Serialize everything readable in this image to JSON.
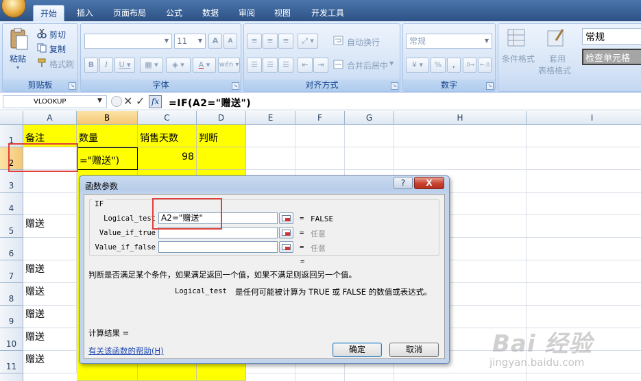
{
  "tabs": [
    {
      "label": "开始",
      "active": true
    },
    {
      "label": "插入"
    },
    {
      "label": "页面布局"
    },
    {
      "label": "公式"
    },
    {
      "label": "数据"
    },
    {
      "label": "审阅"
    },
    {
      "label": "视图"
    },
    {
      "label": "开发工具"
    }
  ],
  "ribbon": {
    "clipboard": {
      "paste": "粘贴",
      "cut": "剪切",
      "copy": "复制",
      "format_painter": "格式刷",
      "group": "剪贴板"
    },
    "font": {
      "name": "",
      "size": "11",
      "group": "字体"
    },
    "alignment": {
      "wrap": "自动换行",
      "merge": "合并后居中",
      "group": "对齐方式"
    },
    "number": {
      "format": "常规",
      "percent": "%",
      "comma": ",",
      "group": "数字"
    },
    "styles": {
      "conditional": "条件格式",
      "table_a": "套用",
      "table_b": "表格格式",
      "style_normal": "常规",
      "style_check": "检查单元格"
    }
  },
  "formula_bar": {
    "name_box": "VLOOKUP",
    "formula": "=IF(A2=\"赠送\")"
  },
  "columns": [
    "A",
    "B",
    "C",
    "D",
    "E",
    "F",
    "G",
    "H",
    "I"
  ],
  "rows": [
    "1",
    "2",
    "3",
    "4",
    "5",
    "6",
    "7",
    "8",
    "9",
    "10",
    "11"
  ],
  "cells": {
    "A1": "备注",
    "B1": "数量",
    "C1": "销售天数",
    "D1": "判断",
    "B2": "=\"赠送\")",
    "C2": "98",
    "A5": "赠送",
    "A7": "赠送",
    "A8": "赠送",
    "A9": "赠送",
    "A10": "赠送",
    "A11": "赠送"
  },
  "dialog": {
    "title": "函数参数",
    "help_btn": "?",
    "close_btn": "X",
    "function_name": "IF",
    "args": [
      {
        "label": "Logical_test",
        "value": "A2=\"赠送\"",
        "result": "FALSE"
      },
      {
        "label": "Value_if_true",
        "value": "",
        "result": "任意"
      },
      {
        "label": "Value_if_false",
        "value": "",
        "result": "任意"
      }
    ],
    "eq_sign": "=",
    "result_eq": "=",
    "description": "判断是否满足某个条件，如果满足返回一个值，如果不满足则返回另一个值。",
    "arg_desc_name": "Logical_test",
    "arg_desc_text": "是任何可能被计算为 TRUE 或 FALSE 的数值或表达式。",
    "calc_result_label": "计算结果 =",
    "help_link": "有关该函数的帮助(H)",
    "ok": "确定",
    "cancel": "取消"
  },
  "watermark": {
    "logo": "Bai 经验",
    "url": "jingyan.baidu.com"
  },
  "colors": {
    "highlight": "#e0403a",
    "yellow_fill": "#ffff00",
    "ribbon_blue": "#15428b"
  }
}
